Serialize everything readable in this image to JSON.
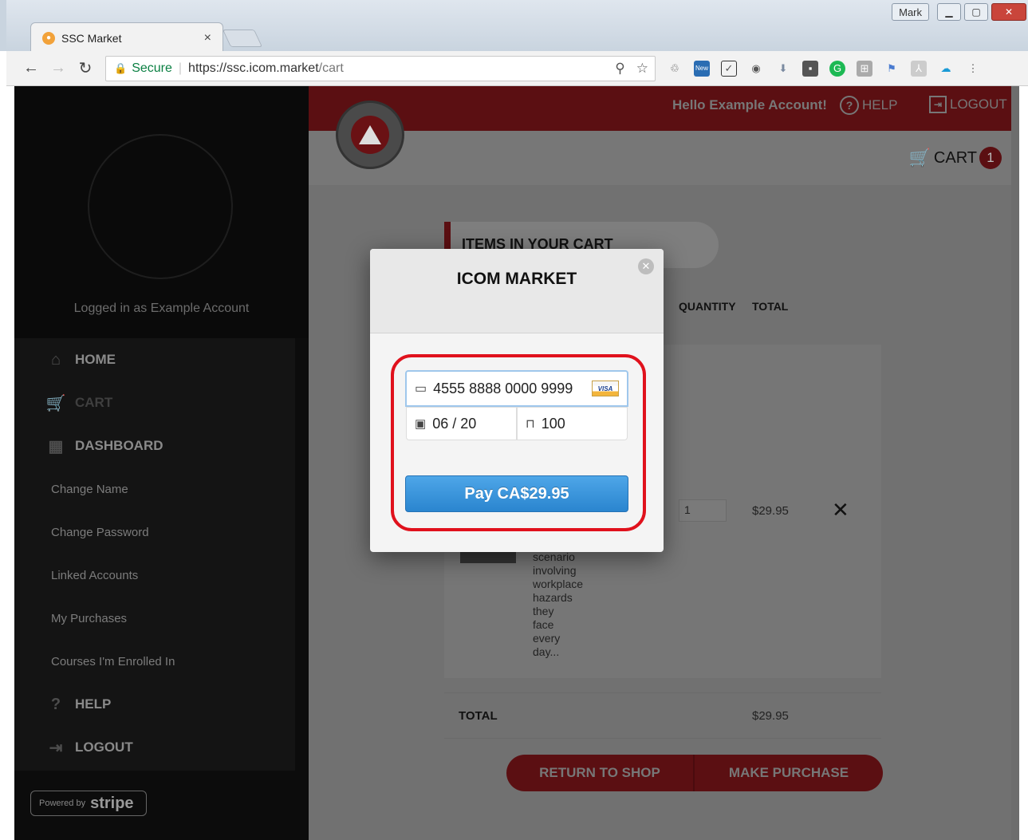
{
  "browser": {
    "tab_title": "SSC Market",
    "tab_close": "×",
    "profile_name": "Mark",
    "secure_label": "Secure",
    "url_host": "https://ssc.icom.market",
    "url_path": "/cart",
    "ext_new_label": "New"
  },
  "header": {
    "greeting": "Hello Example Account!",
    "help": "HELP",
    "logout": "LOGOUT",
    "cart_label": "CART",
    "cart_count": "1"
  },
  "sidebar": {
    "logged_in": "Logged in as Example Account",
    "items": [
      {
        "label": "HOME",
        "icon": "home-icon"
      },
      {
        "label": "CART",
        "icon": "cart-icon"
      },
      {
        "label": "DASHBOARD",
        "icon": "dashboard-icon"
      },
      {
        "label": "Change Name"
      },
      {
        "label": "Change Password"
      },
      {
        "label": "Linked Accounts"
      },
      {
        "label": "My Purchases"
      },
      {
        "label": "Courses I'm Enrolled In"
      },
      {
        "label": "HELP",
        "icon": "help-icon"
      },
      {
        "label": "LOGOUT",
        "icon": "logout-icon"
      }
    ],
    "powered_by": "Powered by",
    "stripe": "stripe"
  },
  "cart": {
    "section_title": "ITEMS IN YOUR CART",
    "columns": {
      "quantity": "QUANTITY",
      "total": "TOTAL"
    },
    "item": {
      "quantity": "1",
      "price": "$29.95",
      "description_lines": [
        "scenario",
        "involving",
        "workplace",
        "hazards",
        "they",
        "face",
        "every",
        "day..."
      ]
    },
    "total_label": "TOTAL",
    "total_value": "$29.95",
    "return_button": "RETURN TO SHOP",
    "purchase_button": "MAKE PURCHASE"
  },
  "modal": {
    "title": "ICOM MARKET",
    "card_number": "4555 8888 0000 9999",
    "card_brand": "VISA",
    "expiry": "06 / 20",
    "cvc": "100",
    "pay_button": "Pay CA$29.95"
  },
  "colors": {
    "brand_red": "#5b0f12",
    "highlight": "#e0111c",
    "pay_blue": "#3b95dc"
  }
}
